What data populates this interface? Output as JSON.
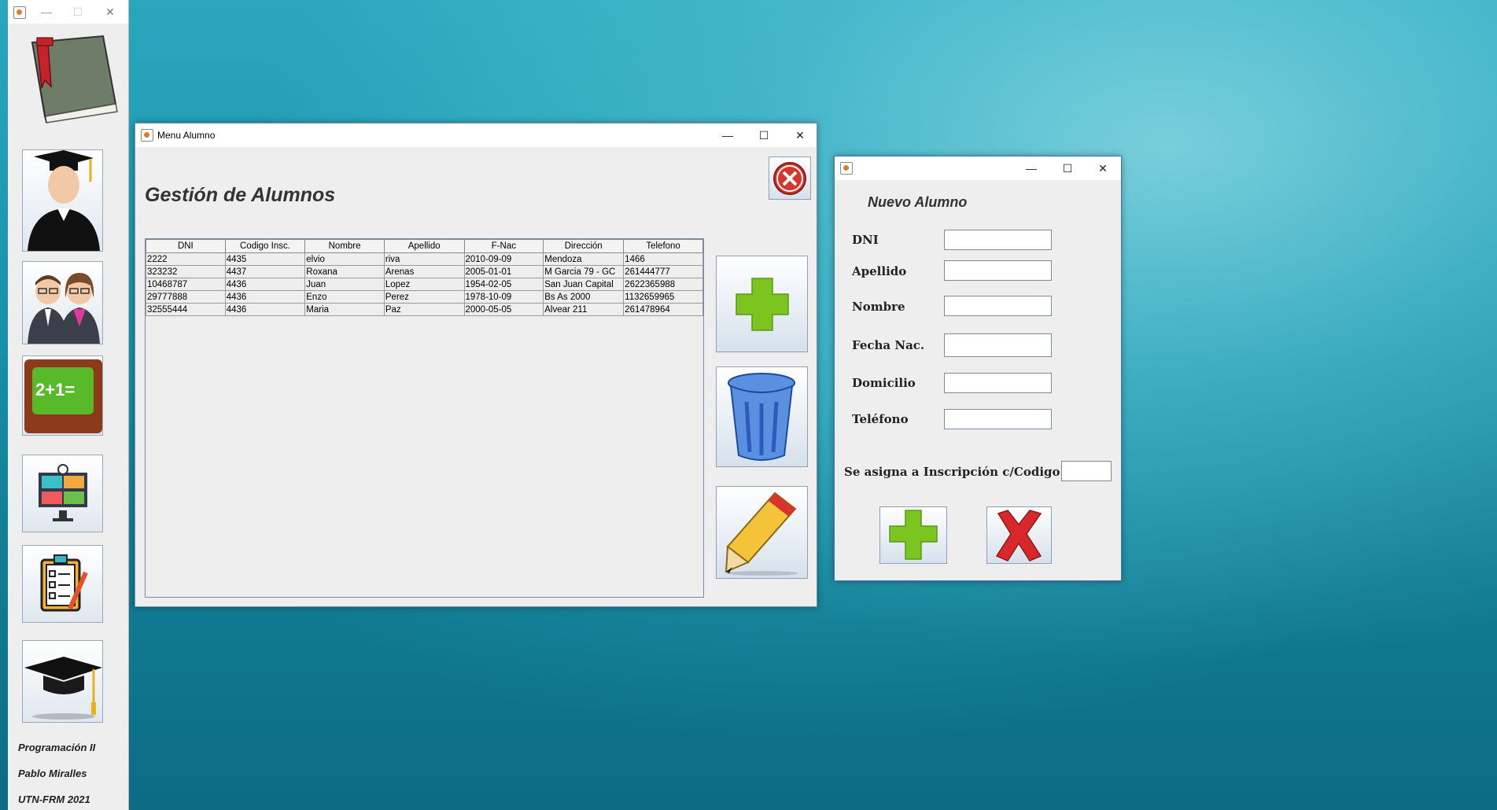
{
  "sidebar": {
    "footer": [
      "Programación II",
      "Pablo Miralles",
      "UTN-FRM 2021"
    ]
  },
  "menu": {
    "title": "Menu Alumno",
    "heading": "Gestión de Alumnos",
    "table": {
      "headers": [
        "DNI",
        "Codigo Insc.",
        "Nombre",
        "Apellido",
        "F-Nac",
        "Dirección",
        "Telefono"
      ],
      "rows": [
        [
          "2222",
          "4435",
          "elvio",
          "riva",
          "2010-09-09",
          "Mendoza",
          "1466"
        ],
        [
          "323232",
          "4437",
          "Roxana",
          "Arenas",
          "2005-01-01",
          "M Garcia 79 - GC",
          "261444777"
        ],
        [
          "10468787",
          "4436",
          "Juan",
          "Lopez",
          "1954-02-05",
          "San Juan Capital",
          "2622365988"
        ],
        [
          "29777888",
          "4436",
          "Enzo",
          "Perez",
          "1978-10-09",
          "Bs As 2000",
          "1132659965"
        ],
        [
          "32555444",
          "4436",
          "Maria",
          "Paz",
          "2000-05-05",
          "Alvear 211",
          "261478964"
        ]
      ]
    }
  },
  "nuevo": {
    "heading": "Nuevo Alumno",
    "fields": {
      "dni": {
        "label": "DNI",
        "value": ""
      },
      "apellido": {
        "label": "Apellido",
        "value": ""
      },
      "nombre": {
        "label": "Nombre",
        "value": ""
      },
      "fecha": {
        "label": "Fecha Nac.",
        "value": ""
      },
      "domicilio": {
        "label": "Domicilio",
        "value": ""
      },
      "telefono": {
        "label": "Teléfono",
        "value": ""
      }
    },
    "codigo_label": "Se asigna a Inscripción c/Codigo:",
    "codigo_value": ""
  },
  "window_controls": {
    "minimize": "—",
    "maximize": "☐",
    "close": "✕"
  },
  "colors": {
    "plus_green": "#7cc41f",
    "cross_red": "#d8282c",
    "close_red": "#d9342b"
  },
  "icons": [
    "book-icon",
    "graduate-icon",
    "teachers-icon",
    "math-board-icon",
    "classroom-network-icon",
    "checklist-icon",
    "graduation-cap-icon",
    "add-icon",
    "trash-icon",
    "pencil-icon",
    "close-icon",
    "cancel-icon"
  ]
}
